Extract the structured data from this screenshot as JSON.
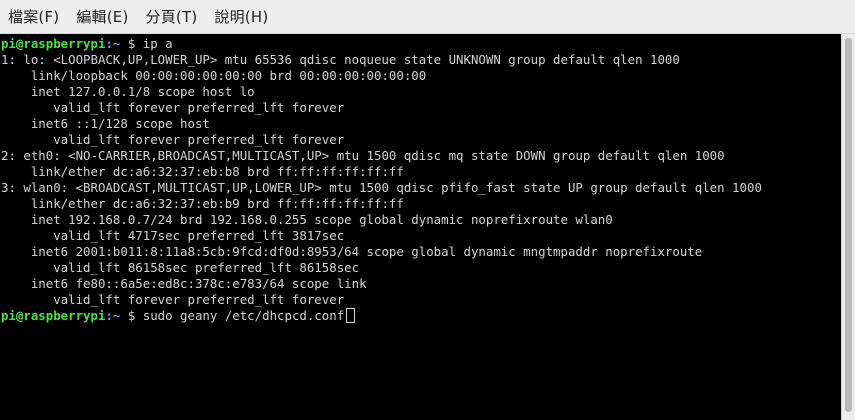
{
  "menu": {
    "file": "檔案(F)",
    "edit": "編輯(E)",
    "tabs": "分頁(T)",
    "help": "說明(H)"
  },
  "prompt": {
    "user": "pi@raspberrypi",
    "path": ":~",
    "symbol": " $ "
  },
  "commands": {
    "first": "ip a",
    "second": "sudo geany /etc/dhcpcd.conf"
  },
  "output": [
    "1: lo: <LOOPBACK,UP,LOWER_UP> mtu 65536 qdisc noqueue state UNKNOWN group default qlen 1000",
    "    link/loopback 00:00:00:00:00:00 brd 00:00:00:00:00:00",
    "    inet 127.0.0.1/8 scope host lo",
    "       valid_lft forever preferred_lft forever",
    "    inet6 ::1/128 scope host",
    "       valid_lft forever preferred_lft forever",
    "2: eth0: <NO-CARRIER,BROADCAST,MULTICAST,UP> mtu 1500 qdisc mq state DOWN group default qlen 1000",
    "    link/ether dc:a6:32:37:eb:b8 brd ff:ff:ff:ff:ff:ff",
    "3: wlan0: <BROADCAST,MULTICAST,UP,LOWER_UP> mtu 1500 qdisc pfifo_fast state UP group default qlen 1000",
    "    link/ether dc:a6:32:37:eb:b9 brd ff:ff:ff:ff:ff:ff",
    "    inet 192.168.0.7/24 brd 192.168.0.255 scope global dynamic noprefixroute wlan0",
    "       valid_lft 4717sec preferred_lft 3817sec",
    "    inet6 2001:b011:8:11a8:5cb:9fcd:df0d:8953/64 scope global dynamic mngtmpaddr noprefixroute",
    "       valid_lft 86158sec preferred_lft 86158sec",
    "    inet6 fe80::6a5e:ed8c:378c:e783/64 scope link",
    "       valid_lft forever preferred_lft forever"
  ],
  "colors": {
    "terminal_bg": "#000000",
    "terminal_fg": "#d3d3d3",
    "prompt_user": "#4be04b",
    "prompt_path": "#6f8ef5",
    "menubar_bg": "#ededed"
  }
}
